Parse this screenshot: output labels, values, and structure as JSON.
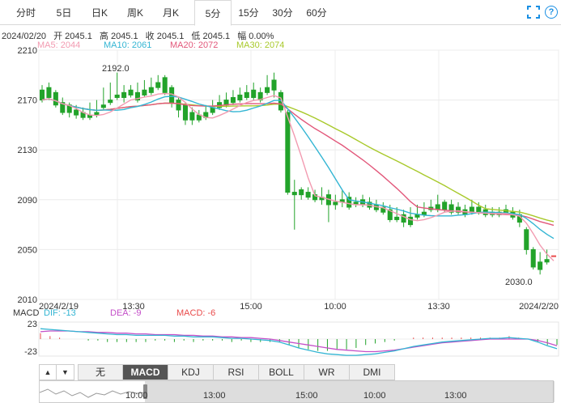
{
  "tabs": [
    "分时",
    "5日",
    "日K",
    "周K",
    "月K",
    "5分",
    "15分",
    "30分",
    "60分"
  ],
  "active_tab": "5分",
  "info": {
    "date": "2024/02/20",
    "open": "开 2045.1",
    "high": "高 2045.1",
    "close": "收 2045.1",
    "low": "低 2045.1",
    "change": "幅 0.00%"
  },
  "ma_legend": {
    "ma5": "MA5: 2044",
    "ma10": "MA10: 2061",
    "ma20": "MA20: 2072",
    "ma30": "MA30: 2074"
  },
  "colors": {
    "up": "#e94b4b",
    "down": "#22a32a",
    "ma5": "#f29ab0",
    "ma10": "#33b5d3",
    "ma20": "#e2577a",
    "ma30": "#a8c92a",
    "dif": "#33b5d3",
    "dea": "#c44fc8",
    "macd": "#e94b4b"
  },
  "price_axis": {
    "ticks": [
      "2210",
      "2170",
      "2130",
      "2090",
      "2050",
      "2010"
    ]
  },
  "time_axis": {
    "labels": [
      "2024/2/19",
      "13:30",
      "15:00",
      "10:00",
      "13:30",
      "2024/2/20"
    ]
  },
  "annotations": {
    "high_label": "2192.0",
    "low_label": "2030.0"
  },
  "macd_legend": {
    "name": "MACD",
    "dif": "DIF: -13",
    "dea": "DEA: -9",
    "macd": "MACD: -6"
  },
  "macd_axis": {
    "top": "23",
    "bottom": "-23"
  },
  "indicator_tabs": [
    "无",
    "MACD",
    "KDJ",
    "RSI",
    "BOLL",
    "WR",
    "DMI"
  ],
  "active_indicator": "MACD",
  "nav_buttons": {
    "up": "▲",
    "down": "▼"
  },
  "navigator": {
    "labels": [
      "10:00",
      "13:00",
      "15:00",
      "10:00",
      "13:00"
    ]
  },
  "chart_data": {
    "type": "candlestick",
    "ylim": [
      2010,
      2210
    ],
    "candles": [
      [
        2178,
        2182,
        2170,
        2168
      ],
      [
        2180,
        2184,
        2172,
        2170
      ],
      [
        2176,
        2178,
        2166,
        2164
      ],
      [
        2168,
        2172,
        2160,
        2158
      ],
      [
        2166,
        2168,
        2160,
        2156
      ],
      [
        2162,
        2166,
        2158,
        2155
      ],
      [
        2160,
        2164,
        2156,
        2154
      ],
      [
        2158,
        2168,
        2156,
        2154
      ],
      [
        2160,
        2170,
        2158,
        2156
      ],
      [
        2166,
        2180,
        2164,
        2162
      ],
      [
        2170,
        2184,
        2168,
        2166
      ],
      [
        2174,
        2192,
        2172,
        2170
      ],
      [
        2176,
        2182,
        2172,
        2168
      ],
      [
        2178,
        2182,
        2174,
        2172
      ],
      [
        2176,
        2184,
        2170,
        2168
      ],
      [
        2178,
        2186,
        2174,
        2172
      ],
      [
        2180,
        2188,
        2176,
        2174
      ],
      [
        2184,
        2190,
        2180,
        2178
      ],
      [
        2188,
        2190,
        2176,
        2174
      ],
      [
        2180,
        2182,
        2168,
        2164
      ],
      [
        2170,
        2172,
        2162,
        2156
      ],
      [
        2166,
        2168,
        2154,
        2150
      ],
      [
        2160,
        2164,
        2154,
        2150
      ],
      [
        2158,
        2162,
        2154,
        2152
      ],
      [
        2160,
        2166,
        2156,
        2154
      ],
      [
        2164,
        2170,
        2160,
        2158
      ],
      [
        2168,
        2174,
        2164,
        2162
      ],
      [
        2170,
        2176,
        2166,
        2164
      ],
      [
        2172,
        2178,
        2168,
        2166
      ],
      [
        2174,
        2180,
        2170,
        2168
      ],
      [
        2176,
        2182,
        2172,
        2170
      ],
      [
        2178,
        2184,
        2172,
        2170
      ],
      [
        2176,
        2180,
        2170,
        2168
      ],
      [
        2180,
        2190,
        2176,
        2174
      ],
      [
        2186,
        2192,
        2178,
        2172
      ],
      [
        2176,
        2178,
        2162,
        2160
      ],
      [
        2160,
        2162,
        2096,
        2094
      ],
      [
        2096,
        2106,
        2094,
        2066
      ],
      [
        2098,
        2100,
        2094,
        2090
      ],
      [
        2096,
        2100,
        2092,
        2090
      ],
      [
        2094,
        2098,
        2090,
        2088
      ],
      [
        2092,
        2100,
        2090,
        2086
      ],
      [
        2094,
        2098,
        2086,
        2072
      ],
      [
        2088,
        2094,
        2086,
        2082
      ],
      [
        2090,
        2098,
        2088,
        2084
      ],
      [
        2092,
        2096,
        2084,
        2082
      ],
      [
        2088,
        2092,
        2086,
        2084
      ],
      [
        2090,
        2094,
        2086,
        2084
      ],
      [
        2088,
        2092,
        2084,
        2082
      ],
      [
        2086,
        2090,
        2082,
        2080
      ],
      [
        2084,
        2088,
        2080,
        2078
      ],
      [
        2082,
        2086,
        2074,
        2072
      ],
      [
        2076,
        2084,
        2074,
        2072
      ],
      [
        2078,
        2082,
        2072,
        2068
      ],
      [
        2076,
        2084,
        2070,
        2068
      ],
      [
        2078,
        2086,
        2076,
        2074
      ],
      [
        2080,
        2088,
        2078,
        2076
      ],
      [
        2084,
        2090,
        2082,
        2080
      ],
      [
        2086,
        2094,
        2082,
        2080
      ],
      [
        2088,
        2090,
        2082,
        2080
      ],
      [
        2086,
        2090,
        2080,
        2078
      ],
      [
        2084,
        2088,
        2080,
        2078
      ],
      [
        2082,
        2086,
        2078,
        2076
      ],
      [
        2084,
        2090,
        2080,
        2078
      ],
      [
        2084,
        2088,
        2080,
        2078
      ],
      [
        2082,
        2086,
        2078,
        2076
      ],
      [
        2080,
        2084,
        2078,
        2076
      ],
      [
        2080,
        2084,
        2078,
        2076
      ],
      [
        2082,
        2086,
        2080,
        2078
      ],
      [
        2080,
        2084,
        2076,
        2074
      ],
      [
        2078,
        2082,
        2072,
        2068
      ],
      [
        2066,
        2068,
        2050,
        2046
      ],
      [
        2050,
        2052,
        2036,
        2034
      ],
      [
        2040,
        2048,
        2034,
        2030
      ],
      [
        2042,
        2050,
        2040,
        2038
      ],
      [
        2045,
        2045,
        2045,
        2045
      ]
    ],
    "macd": {
      "ylim": [
        -23,
        23
      ],
      "dif": [
        14,
        13,
        12,
        11,
        10,
        9,
        8,
        7,
        6,
        6,
        5,
        5,
        5,
        5,
        4,
        4,
        3,
        3,
        3,
        2,
        1,
        1,
        0,
        -1,
        -2,
        -4,
        -8,
        -12,
        -15,
        -18,
        -20,
        -21,
        -22,
        -22,
        -21,
        -20,
        -18,
        -16,
        -13,
        -10,
        -8,
        -6,
        -4,
        -3,
        -2,
        -1,
        0,
        1,
        1,
        2,
        1,
        0,
        -4,
        -9,
        -13
      ],
      "dea": [
        10,
        11,
        11,
        11,
        10,
        10,
        9,
        9,
        8,
        8,
        7,
        7,
        6,
        6,
        6,
        5,
        5,
        4,
        4,
        3,
        3,
        2,
        2,
        1,
        0,
        -2,
        -4,
        -6,
        -8,
        -10,
        -12,
        -14,
        -15,
        -16,
        -17,
        -17,
        -16,
        -15,
        -13,
        -11,
        -9,
        -7,
        -5,
        -4,
        -3,
        -2,
        -1,
        0,
        0,
        0,
        0,
        0,
        -2,
        -5,
        -9
      ]
    }
  }
}
